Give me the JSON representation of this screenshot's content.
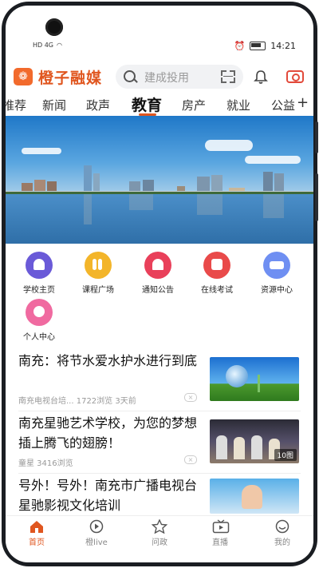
{
  "status_bar": {
    "network": "HD 4G",
    "time": "14:21"
  },
  "header": {
    "app_name": "橙子融媒",
    "search_placeholder": "建成投用",
    "icons": [
      "logo-icon",
      "search-icon",
      "scan-icon",
      "bell-icon",
      "camera-icon"
    ]
  },
  "tabs": [
    {
      "label": "推荐"
    },
    {
      "label": "新闻"
    },
    {
      "label": "政声"
    },
    {
      "label": "教育",
      "active": true
    },
    {
      "label": "房产"
    },
    {
      "label": "就业"
    },
    {
      "label": "公益"
    }
  ],
  "services": [
    {
      "label": "学校主页",
      "color": "#6a5ad8"
    },
    {
      "label": "课程广场",
      "color": "#f3b52a"
    },
    {
      "label": "通知公告",
      "color": "#e9405a"
    },
    {
      "label": "在线考试",
      "color": "#e94a4a"
    },
    {
      "label": "资源中心",
      "color": "#6f8ff2"
    },
    {
      "label": "个人中心",
      "color": "#f06aa0"
    }
  ],
  "news": [
    {
      "title": "南充：将节水爱水护水进行到底",
      "meta": "南充电视台培... 1722浏览 3天前"
    },
    {
      "title": "南充星驰艺术学校，为您的梦想插上腾飞的翅膀！",
      "meta": "童星 3416浏览",
      "badge": "10图"
    },
    {
      "title": "号外！号外！南充市广播电视台星驰影视文化培训",
      "meta": ""
    }
  ],
  "bottom_nav": [
    {
      "label": "首页",
      "active": true
    },
    {
      "label": "橙live"
    },
    {
      "label": "问政"
    },
    {
      "label": "直播"
    },
    {
      "label": "我的"
    }
  ],
  "colors": {
    "accent": "#e0561f",
    "frame": "#1a1d22"
  }
}
